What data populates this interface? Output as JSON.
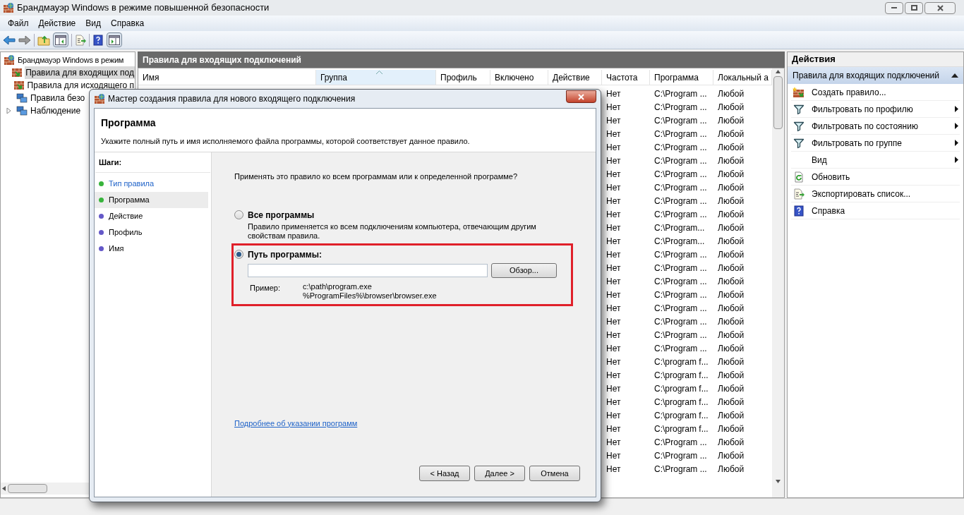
{
  "window": {
    "title": "Брандмауэр Windows в режиме повышенной безопасности"
  },
  "menu": [
    "Файл",
    "Действие",
    "Вид",
    "Справка"
  ],
  "tree": {
    "label": "Брандмауэр Windows в режим",
    "children": [
      {
        "label": "Правила для входящих под",
        "selected": true
      },
      {
        "label": "Правила для исходящего п",
        "selected": false
      },
      {
        "label": "Правила безо",
        "selected": false
      },
      {
        "label": "Наблюдение",
        "selected": false,
        "expanded": false
      }
    ]
  },
  "rules": {
    "title": "Правила для входящих подключений",
    "columns": [
      {
        "label": "Имя",
        "sorted": false
      },
      {
        "label": "Группа",
        "sorted": true
      },
      {
        "label": "Профиль",
        "sorted": false
      },
      {
        "label": "Включено",
        "sorted": false
      },
      {
        "label": "Действие",
        "sorted": false
      },
      {
        "label": "Частота",
        "sorted": false
      },
      {
        "label": "Программа",
        "sorted": false
      },
      {
        "label": "Локальный а",
        "sorted": false
      }
    ],
    "rows": [
      {
        "cells": [
          "Нет",
          "C:\\Program ...",
          "Любой"
        ]
      },
      {
        "cells": [
          "Нет",
          "C:\\Program ...",
          "Любой"
        ]
      },
      {
        "cells": [
          "Нет",
          "C:\\Program ...",
          "Любой"
        ]
      },
      {
        "cells": [
          "Нет",
          "C:\\Program ...",
          "Любой"
        ]
      },
      {
        "cells": [
          "Нет",
          "C:\\Program ...",
          "Любой"
        ]
      },
      {
        "cells": [
          "Нет",
          "C:\\Program ...",
          "Любой"
        ]
      },
      {
        "cells": [
          "Нет",
          "C:\\Program ...",
          "Любой"
        ]
      },
      {
        "cells": [
          "Нет",
          "C:\\Program ...",
          "Любой"
        ]
      },
      {
        "cells": [
          "Нет",
          "C:\\Program ...",
          "Любой"
        ]
      },
      {
        "cells": [
          "Нет",
          "C:\\Program ...",
          "Любой"
        ]
      },
      {
        "cells": [
          "Нет",
          "C:\\Program...",
          "Любой"
        ]
      },
      {
        "cells": [
          "Нет",
          "C:\\Program...",
          "Любой"
        ]
      },
      {
        "cells": [
          "Нет",
          "C:\\Program ...",
          "Любой"
        ]
      },
      {
        "cells": [
          "Нет",
          "C:\\Program ...",
          "Любой"
        ]
      },
      {
        "cells": [
          "Нет",
          "C:\\Program ...",
          "Любой"
        ]
      },
      {
        "cells": [
          "Нет",
          "C:\\Program ...",
          "Любой"
        ]
      },
      {
        "cells": [
          "Нет",
          "C:\\Program ...",
          "Любой"
        ]
      },
      {
        "cells": [
          "Нет",
          "C:\\Program ...",
          "Любой"
        ]
      },
      {
        "cells": [
          "Нет",
          "C:\\Program ...",
          "Любой"
        ]
      },
      {
        "cells": [
          "Нет",
          "C:\\Program ...",
          "Любой"
        ]
      },
      {
        "cells": [
          "Нет",
          "C:\\program f...",
          "Любой"
        ]
      },
      {
        "cells": [
          "Нет",
          "C:\\program f...",
          "Любой"
        ]
      },
      {
        "cells": [
          "Нет",
          "C:\\program f...",
          "Любой"
        ]
      },
      {
        "cells": [
          "Нет",
          "C:\\program f...",
          "Любой"
        ]
      },
      {
        "cells": [
          "Нет",
          "C:\\program f...",
          "Любой"
        ]
      },
      {
        "cells": [
          "Нет",
          "C:\\program f...",
          "Любой"
        ]
      },
      {
        "cells": [
          "Нет",
          "C:\\Program ...",
          "Любой"
        ]
      },
      {
        "cells": [
          "Нет",
          "C:\\Program ...",
          "Любой"
        ]
      },
      {
        "cells": [
          "Нет",
          "C:\\Program ...",
          "Любой"
        ]
      }
    ]
  },
  "actions": {
    "title": "Действия",
    "section": {
      "label": "Правила для входящих подключений",
      "expanded": true
    },
    "items": [
      {
        "label": "Создать правило...",
        "submenu": false
      },
      {
        "label": "Фильтровать по профилю",
        "submenu": true
      },
      {
        "label": "Фильтровать по состоянию",
        "submenu": true
      },
      {
        "label": "Фильтровать по группе",
        "submenu": true
      },
      {
        "label": "Вид",
        "submenu": true
      },
      {
        "label": "Обновить",
        "submenu": false
      },
      {
        "label": "Экспортировать список...",
        "submenu": false
      },
      {
        "label": "Справка",
        "submenu": false
      }
    ]
  },
  "dialog": {
    "title": "Мастер создания правила для нового входящего подключения",
    "heading": "Программа",
    "description": "Укажите полный путь и имя исполняемого файла программы, которой соответствует данное правило.",
    "steps_title": "Шаги:",
    "steps": [
      {
        "label": "Тип правила",
        "selected": false,
        "completed": true
      },
      {
        "label": "Программа",
        "selected": true,
        "completed": true
      },
      {
        "label": "Действие",
        "selected": false,
        "completed": false
      },
      {
        "label": "Профиль",
        "selected": false,
        "completed": false
      },
      {
        "label": "Имя",
        "selected": false,
        "completed": false
      }
    ],
    "question": "Применять это правило ко всем программам или к определенной программе?",
    "options": [
      {
        "kind": "all",
        "label": "Все программы",
        "selected": false,
        "highlighted": false,
        "description": "Правило применяется ко всем подключениям компьютера, отвечающим другим свойствам правила."
      },
      {
        "kind": "path",
        "label": "Путь программы:",
        "selected": true,
        "highlighted": true,
        "browse_button": "Обзор...",
        "example_label": "Пример:",
        "examples": [
          "c:\\path\\program.exe",
          "%ProgramFiles%\\browser\\browser.exe"
        ]
      }
    ],
    "help_link": "Подробнее об указании программ",
    "buttons": [
      "< Назад",
      "Далее >",
      "Отмена"
    ]
  }
}
